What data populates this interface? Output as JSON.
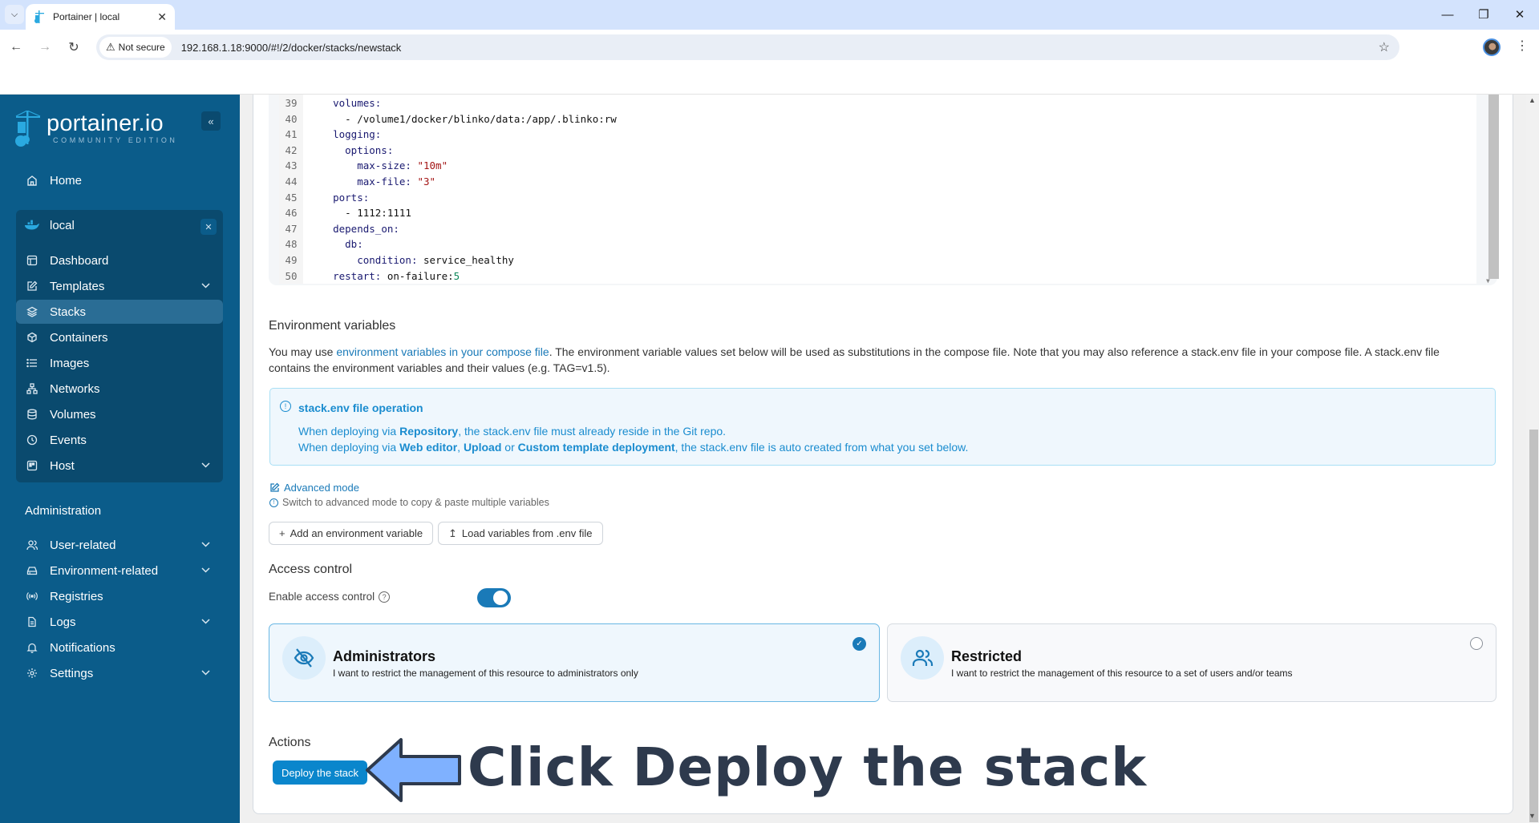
{
  "browser": {
    "tab_title": "Portainer | local",
    "not_secure_label": "Not secure",
    "url": "192.168.1.18:9000/#!/2/docker/stacks/newstack"
  },
  "sidebar": {
    "logo_main": "portainer.io",
    "logo_sub": "COMMUNITY EDITION",
    "collapse_glyph": "«",
    "home_label": "Home",
    "environment_name": "local",
    "env_items": [
      {
        "label": "Dashboard",
        "icon": "dashboard-icon",
        "chevron": false,
        "active": false
      },
      {
        "label": "Templates",
        "icon": "edit-icon",
        "chevron": true,
        "active": false
      },
      {
        "label": "Stacks",
        "icon": "layers-icon",
        "chevron": false,
        "active": true
      },
      {
        "label": "Containers",
        "icon": "box-icon",
        "chevron": false,
        "active": false
      },
      {
        "label": "Images",
        "icon": "list-icon",
        "chevron": false,
        "active": false
      },
      {
        "label": "Networks",
        "icon": "network-icon",
        "chevron": false,
        "active": false
      },
      {
        "label": "Volumes",
        "icon": "database-icon",
        "chevron": false,
        "active": false
      },
      {
        "label": "Events",
        "icon": "clock-icon",
        "chevron": false,
        "active": false
      },
      {
        "label": "Host",
        "icon": "host-icon",
        "chevron": true,
        "active": false
      }
    ],
    "admin_title": "Administration",
    "admin_items": [
      {
        "label": "User-related",
        "icon": "users-icon",
        "chevron": true
      },
      {
        "label": "Environment-related",
        "icon": "drive-icon",
        "chevron": true
      },
      {
        "label": "Registries",
        "icon": "radio-icon",
        "chevron": false
      },
      {
        "label": "Logs",
        "icon": "file-icon",
        "chevron": true
      },
      {
        "label": "Notifications",
        "icon": "bell-icon",
        "chevron": false
      },
      {
        "label": "Settings",
        "icon": "gear-icon",
        "chevron": true
      }
    ]
  },
  "editor": {
    "lines": [
      {
        "n": "39",
        "indent": "    ",
        "parts": [
          [
            "k",
            "volumes:"
          ]
        ]
      },
      {
        "n": "40",
        "indent": "      ",
        "parts": [
          [
            "p",
            "- /volume1/docker/blinko/data:/app/.blinko:rw"
          ]
        ]
      },
      {
        "n": "41",
        "indent": "    ",
        "parts": [
          [
            "k",
            "logging:"
          ]
        ]
      },
      {
        "n": "42",
        "indent": "      ",
        "parts": [
          [
            "k",
            "options:"
          ]
        ]
      },
      {
        "n": "43",
        "indent": "        ",
        "parts": [
          [
            "k",
            "max-size: "
          ],
          [
            "s",
            "\"10m\""
          ]
        ]
      },
      {
        "n": "44",
        "indent": "        ",
        "parts": [
          [
            "k",
            "max-file: "
          ],
          [
            "s",
            "\"3\""
          ]
        ]
      },
      {
        "n": "45",
        "indent": "    ",
        "parts": [
          [
            "k",
            "ports:"
          ]
        ]
      },
      {
        "n": "46",
        "indent": "      ",
        "parts": [
          [
            "p",
            "- 1112:1111"
          ]
        ]
      },
      {
        "n": "47",
        "indent": "    ",
        "parts": [
          [
            "k",
            "depends_on:"
          ]
        ]
      },
      {
        "n": "48",
        "indent": "      ",
        "parts": [
          [
            "k",
            "db:"
          ]
        ]
      },
      {
        "n": "49",
        "indent": "        ",
        "parts": [
          [
            "k",
            "condition: "
          ],
          [
            "p",
            "service_healthy"
          ]
        ]
      },
      {
        "n": "50",
        "indent": "    ",
        "parts": [
          [
            "k",
            "restart: "
          ],
          [
            "p",
            "on-failure:"
          ],
          [
            "n",
            "5"
          ]
        ]
      }
    ]
  },
  "env_vars": {
    "title": "Environment variables",
    "para_prefix": "You may use ",
    "para_link": "environment variables in your compose file",
    "para_suffix": ". The environment variable values set below will be used as substitutions in the compose file. Note that you may also reference a stack.env file in your compose file. A stack.env file contains the environment variables and their values (e.g. TAG=v1.5).",
    "info_title": "stack.env file operation",
    "info_line1": {
      "a": "When deploying via ",
      "b1": "Repository",
      "c": ", the stack.env file must already reside in the Git repo."
    },
    "info_line2": {
      "a": "When deploying via ",
      "b1": "Web editor",
      "sep1": ", ",
      "b2": "Upload",
      "sep2": " or ",
      "b3": "Custom template deployment",
      "c": ", the stack.env file is auto created from what you set below."
    },
    "advanced_mode_label": "Advanced mode",
    "advanced_hint": "Switch to advanced mode to copy & paste multiple variables",
    "add_var_label": "Add an environment variable",
    "load_env_label": "Load variables from .env file"
  },
  "access_control": {
    "title": "Access control",
    "enable_label": "Enable access control",
    "enabled": true,
    "options": [
      {
        "title": "Administrators",
        "desc": "I want to restrict the management of this resource to administrators only",
        "selected": true
      },
      {
        "title": "Restricted",
        "desc": "I want to restrict the management of this resource to a set of users and/or teams",
        "selected": false
      }
    ]
  },
  "actions": {
    "title": "Actions",
    "deploy_label": "Deploy the stack"
  },
  "annotation": {
    "text": "Click Deploy the stack"
  }
}
